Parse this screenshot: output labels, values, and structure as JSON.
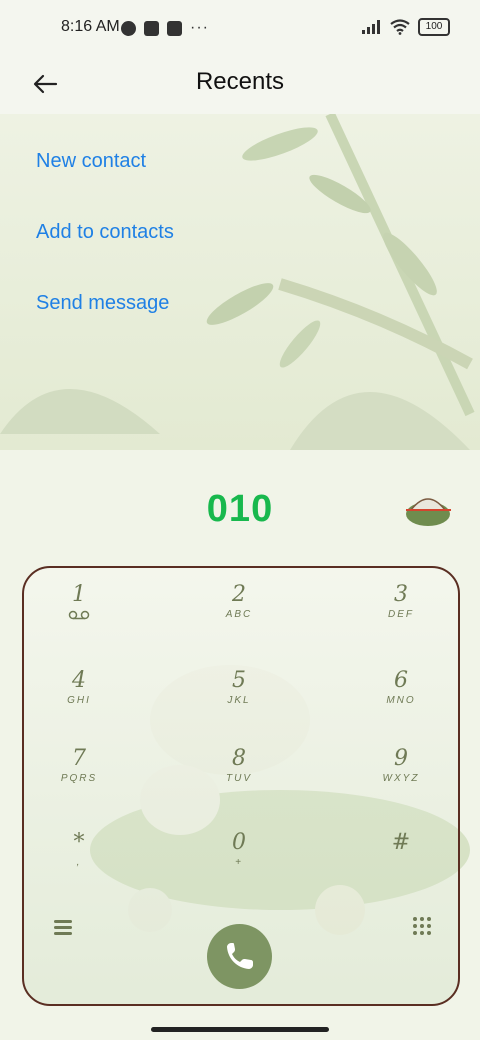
{
  "status": {
    "time": "8:16 AM",
    "battery": "100"
  },
  "header": {
    "title": "Recents"
  },
  "menu": [
    {
      "label": "New contact"
    },
    {
      "label": "Add to contacts"
    },
    {
      "label": "Send message"
    }
  ],
  "dialer": {
    "number": "010",
    "keys": [
      {
        "digit": "1",
        "letters": ""
      },
      {
        "digit": "2",
        "letters": "ABC"
      },
      {
        "digit": "3",
        "letters": "DEF"
      },
      {
        "digit": "4",
        "letters": "GHI"
      },
      {
        "digit": "5",
        "letters": "JKL"
      },
      {
        "digit": "6",
        "letters": "MNO"
      },
      {
        "digit": "7",
        "letters": "PQRS"
      },
      {
        "digit": "8",
        "letters": "TUV"
      },
      {
        "digit": "9",
        "letters": "WXYZ"
      },
      {
        "digit": "*",
        "letters": ","
      },
      {
        "digit": "0",
        "letters": "+"
      },
      {
        "digit": "#",
        "letters": ""
      }
    ]
  },
  "colors": {
    "accent_blue": "#1f80e5",
    "number_green": "#18b84d",
    "call_green": "#7e9563",
    "frame": "#5a2e22"
  }
}
